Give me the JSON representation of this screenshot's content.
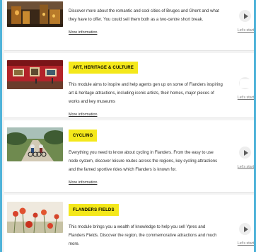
{
  "modules": [
    {
      "id": "cities",
      "badge": "",
      "description": "Discover more about the romantic and cool cities of Bruges and Ghent and what they have to offer. You could sell them both as a two-centre short break.",
      "more_label": "More information",
      "start_label": "Let's start"
    },
    {
      "id": "art",
      "badge": "ART, HERITAGE & CULTURE",
      "description": "This module aims to inspire and help agents gen up on some of Flanders inspiring art & heritage attractions, including iconic artists, their homes, major pieces of works and key museums",
      "more_label": "More information",
      "start_label": "Let's start"
    },
    {
      "id": "cycling",
      "badge": "CYCLING",
      "description": "Everything you need to know about cycling in Flanders. From the easy to use node system, discover leisure routes across the regions, key cycling attractions and the famed sportive rides which Flanders is known for.",
      "more_label": "More information",
      "start_label": "Let's start"
    },
    {
      "id": "fields",
      "badge": "FLANDERS FIELDS",
      "description": "This module brings you a wealth of knowledge to help you sell Ypres and Flanders Fields. Discover the region, the commemorative attractions and much more.",
      "more_label": "More information",
      "start_label": "Let's start"
    }
  ],
  "icons": {
    "play": "play-icon"
  },
  "colors": {
    "frame": "#4fb3d9",
    "badge": "#f4e81b",
    "background": "#f3f3f3"
  }
}
